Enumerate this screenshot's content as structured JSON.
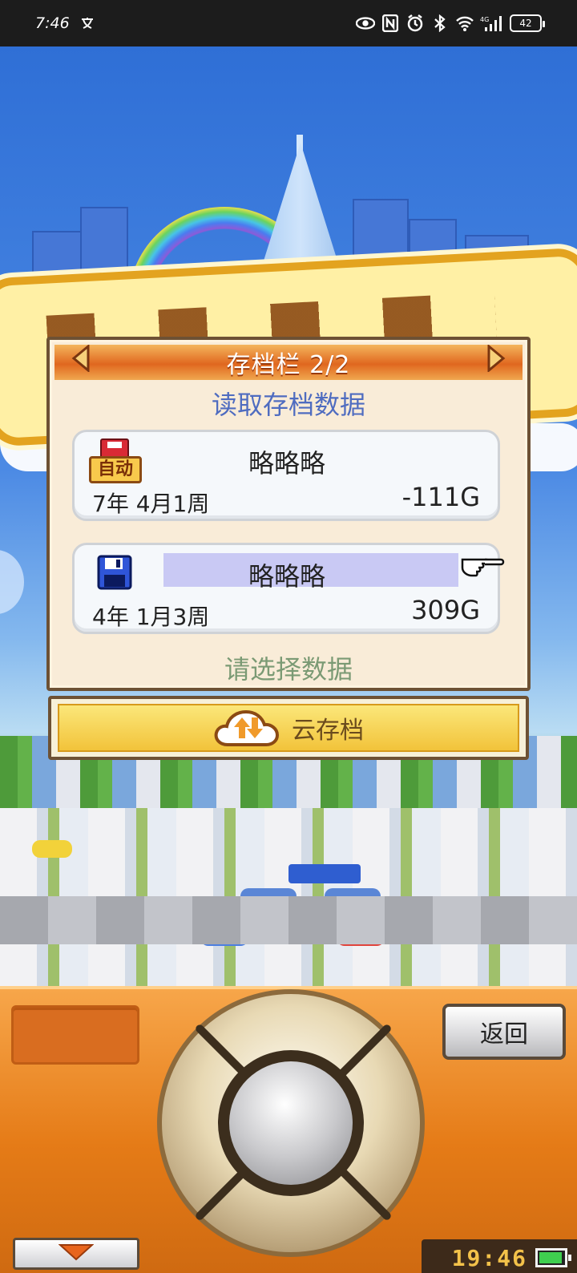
{
  "status_bar": {
    "time": "7:46",
    "icons": [
      "translate-icon",
      "eye-icon",
      "nfc-icon",
      "alarm-icon",
      "bluetooth-icon",
      "wifi-icon",
      "signal-4g-icon"
    ],
    "network_label": "4G",
    "battery": "42"
  },
  "dialog": {
    "title": "存档栏 2/2",
    "subtitle": "读取存档数据",
    "hint": "请选择数据",
    "slots": [
      {
        "icon": "auto-save-icon",
        "badge": "自动",
        "name": "略略略",
        "date": "7年 4月1周",
        "money": "-111G",
        "selected": false
      },
      {
        "icon": "floppy-disk-icon",
        "name": "略略略",
        "date": "4年 1月3周",
        "money": "309G",
        "selected": true
      }
    ]
  },
  "cloud_save": {
    "label": "云存档",
    "icon": "cloud-upload-download-icon"
  },
  "controller": {
    "back_label": "返回",
    "clock": "19:46",
    "battery_icon": "battery-icon"
  },
  "colors": {
    "header_orange": "#e0671f",
    "subtitle_blue": "#4f6cc0",
    "hint_green": "#7b9a74",
    "highlight": "#c9c9f4",
    "controller_orange": "#e57b17"
  }
}
